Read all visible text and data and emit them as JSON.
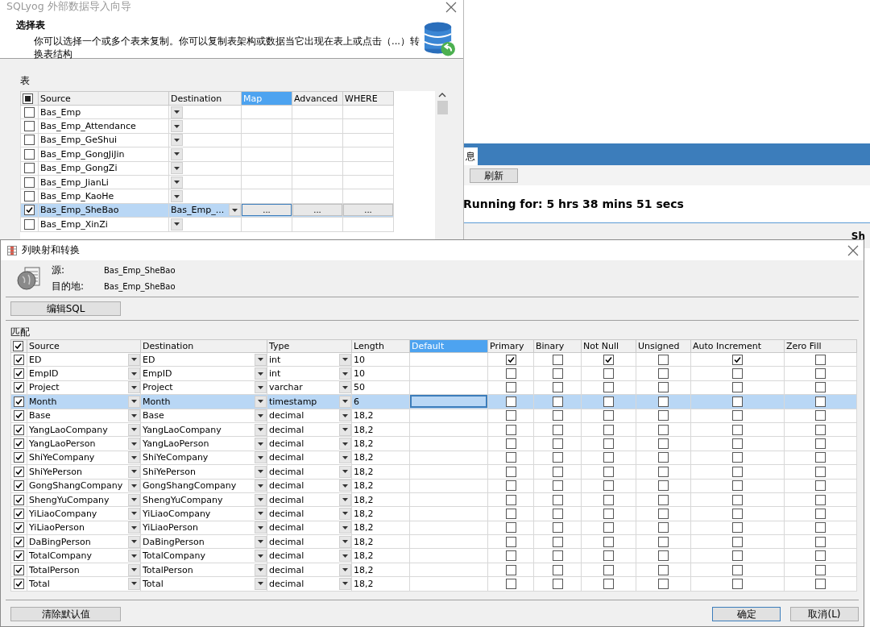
{
  "wizard": {
    "title": "SQLyog 外部数据导入向导",
    "heading": "选择表",
    "description": "你可以选择一个或多个表来复制。你可以复制表架构或数据当它出现在表上或点击（...）转换表结构",
    "table_label": "表",
    "header_mixed": true,
    "columns": [
      {
        "label": "Source",
        "kind": "text",
        "selected": false
      },
      {
        "label": "Destination",
        "kind": "combo",
        "selected": false
      },
      {
        "label": "Map",
        "kind": "action",
        "selected": true
      },
      {
        "label": "Advanced",
        "kind": "action",
        "selected": false
      },
      {
        "label": "WHERE",
        "kind": "action",
        "selected": false
      }
    ],
    "rows": [
      {
        "checked": false,
        "selected": false,
        "values": [
          "Bas_Emp"
        ]
      },
      {
        "checked": false,
        "selected": false,
        "values": [
          "Bas_Emp_Attendance"
        ]
      },
      {
        "checked": false,
        "selected": false,
        "values": [
          "Bas_Emp_GeShui"
        ]
      },
      {
        "checked": false,
        "selected": false,
        "values": [
          "Bas_Emp_GongJiJin"
        ]
      },
      {
        "checked": false,
        "selected": false,
        "values": [
          "Bas_Emp_GongZi"
        ]
      },
      {
        "checked": false,
        "selected": false,
        "values": [
          "Bas_Emp_JianLi"
        ]
      },
      {
        "checked": false,
        "selected": false,
        "values": [
          "Bas_Emp_KaoHe"
        ]
      },
      {
        "checked": true,
        "selected": true,
        "values": [
          "Bas_Emp_SheBao",
          "Bas_Emp_...",
          "...",
          "...",
          "..."
        ]
      },
      {
        "checked": false,
        "selected": false,
        "values": [
          "Bas_Emp_XinZi"
        ]
      }
    ]
  },
  "background_window": {
    "tab": "息",
    "refresh_button": "刷新",
    "status": "Running for: 5 hrs 38 mins 51 secs",
    "cut_label": "Sh"
  },
  "dialog": {
    "title": "列映射和转换",
    "source_label": "源:",
    "source_value": "Bas_Emp_SheBao",
    "destination_label": "目的地:",
    "destination_value": "Bas_Emp_SheBao",
    "edit_sql_button": "编辑SQL",
    "match_label": "匹配",
    "header_checked": true,
    "columns": [
      {
        "label": "Source",
        "kind": "combo",
        "selected": false
      },
      {
        "label": "Destination",
        "kind": "combo",
        "selected": false
      },
      {
        "label": "Type",
        "kind": "combo",
        "selected": false
      },
      {
        "label": "Length",
        "kind": "text",
        "selected": false
      },
      {
        "label": "Default",
        "kind": "text",
        "selected": true
      },
      {
        "label": "Primary",
        "kind": "flag",
        "selected": false
      },
      {
        "label": "Binary",
        "kind": "flag",
        "selected": false
      },
      {
        "label": "Not Null",
        "kind": "flag",
        "selected": false
      },
      {
        "label": "Unsigned",
        "kind": "flag",
        "selected": false
      },
      {
        "label": "Auto Increment",
        "kind": "flag",
        "selected": false
      },
      {
        "label": "Zero Fill",
        "kind": "flag",
        "selected": false
      }
    ],
    "rows": [
      {
        "checked": true,
        "selected": false,
        "values": [
          "ED",
          "ED",
          "int",
          "10"
        ],
        "flags": [
          true,
          false,
          true,
          false,
          true,
          false
        ]
      },
      {
        "checked": true,
        "selected": false,
        "values": [
          "EmpID",
          "EmpID",
          "int",
          "10"
        ],
        "flags": [
          false,
          false,
          false,
          false,
          false,
          false
        ]
      },
      {
        "checked": true,
        "selected": false,
        "values": [
          "Project",
          "Project",
          "varchar",
          "50"
        ],
        "flags": [
          false,
          false,
          false,
          false,
          false,
          false
        ]
      },
      {
        "checked": true,
        "selected": true,
        "values": [
          "Month",
          "Month",
          "timestamp",
          "6"
        ],
        "flags": [
          false,
          false,
          false,
          false,
          false,
          false
        ]
      },
      {
        "checked": true,
        "selected": false,
        "values": [
          "Base",
          "Base",
          "decimal",
          "18,2"
        ],
        "flags": [
          false,
          false,
          false,
          false,
          false,
          false
        ]
      },
      {
        "checked": true,
        "selected": false,
        "values": [
          "YangLaoCompany",
          "YangLaoCompany",
          "decimal",
          "18,2"
        ],
        "flags": [
          false,
          false,
          false,
          false,
          false,
          false
        ]
      },
      {
        "checked": true,
        "selected": false,
        "values": [
          "YangLaoPerson",
          "YangLaoPerson",
          "decimal",
          "18,2"
        ],
        "flags": [
          false,
          false,
          false,
          false,
          false,
          false
        ]
      },
      {
        "checked": true,
        "selected": false,
        "values": [
          "ShiYeCompany",
          "ShiYeCompany",
          "decimal",
          "18,2"
        ],
        "flags": [
          false,
          false,
          false,
          false,
          false,
          false
        ]
      },
      {
        "checked": true,
        "selected": false,
        "values": [
          "ShiYePerson",
          "ShiYePerson",
          "decimal",
          "18,2"
        ],
        "flags": [
          false,
          false,
          false,
          false,
          false,
          false
        ]
      },
      {
        "checked": true,
        "selected": false,
        "values": [
          "GongShangCompany",
          "GongShangCompany",
          "decimal",
          "18,2"
        ],
        "flags": [
          false,
          false,
          false,
          false,
          false,
          false
        ]
      },
      {
        "checked": true,
        "selected": false,
        "values": [
          "ShengYuCompany",
          "ShengYuCompany",
          "decimal",
          "18,2"
        ],
        "flags": [
          false,
          false,
          false,
          false,
          false,
          false
        ]
      },
      {
        "checked": true,
        "selected": false,
        "values": [
          "YiLiaoCompany",
          "YiLiaoCompany",
          "decimal",
          "18,2"
        ],
        "flags": [
          false,
          false,
          false,
          false,
          false,
          false
        ]
      },
      {
        "checked": true,
        "selected": false,
        "values": [
          "YiLiaoPerson",
          "YiLiaoPerson",
          "decimal",
          "18,2"
        ],
        "flags": [
          false,
          false,
          false,
          false,
          false,
          false
        ]
      },
      {
        "checked": true,
        "selected": false,
        "values": [
          "DaBingPerson",
          "DaBingPerson",
          "decimal",
          "18,2"
        ],
        "flags": [
          false,
          false,
          false,
          false,
          false,
          false
        ]
      },
      {
        "checked": true,
        "selected": false,
        "values": [
          "TotalCompany",
          "TotalCompany",
          "decimal",
          "18,2"
        ],
        "flags": [
          false,
          false,
          false,
          false,
          false,
          false
        ]
      },
      {
        "checked": true,
        "selected": false,
        "values": [
          "TotalPerson",
          "TotalPerson",
          "decimal",
          "18,2"
        ],
        "flags": [
          false,
          false,
          false,
          false,
          false,
          false
        ]
      },
      {
        "checked": true,
        "selected": false,
        "values": [
          "Total",
          "Total",
          "decimal",
          "18,2"
        ],
        "flags": [
          false,
          false,
          false,
          false,
          false,
          false
        ]
      }
    ],
    "clear_button": "清除默认值",
    "buttons": [
      {
        "label": "确定",
        "default": true
      },
      {
        "label": "取消(L)",
        "default": false
      }
    ]
  }
}
